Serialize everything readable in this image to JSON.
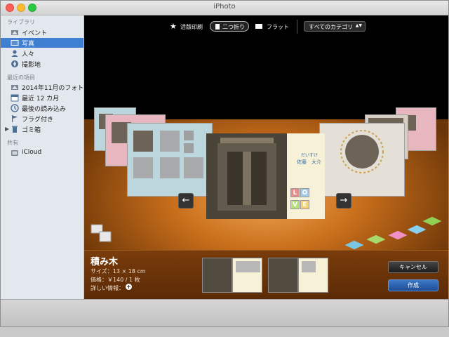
{
  "window": {
    "title": "iPhoto"
  },
  "sidebar": {
    "sections": [
      {
        "heading": "ライブラリ",
        "items": [
          {
            "label": "イベント",
            "icon": "events-icon"
          },
          {
            "label": "写真",
            "icon": "photos-icon",
            "selected": true
          },
          {
            "label": "人々",
            "icon": "people-icon"
          },
          {
            "label": "撮影地",
            "icon": "places-icon"
          }
        ]
      },
      {
        "heading": "最近の項目",
        "items": [
          {
            "label": "2014年11月のフォト…",
            "icon": "event-icon"
          },
          {
            "label": "最近 12 カ月",
            "icon": "calendar-icon"
          },
          {
            "label": "最後の読み込み",
            "icon": "last-import-icon"
          },
          {
            "label": "フラグ付き",
            "icon": "flag-icon"
          },
          {
            "label": "ゴミ箱",
            "icon": "trash-icon"
          }
        ]
      },
      {
        "heading": "共有",
        "items": [
          {
            "label": "iCloud",
            "icon": "icloud-icon"
          }
        ]
      }
    ]
  },
  "toolbar": {
    "letterpress": "活版印刷",
    "folded": "二つ折り",
    "flat": "フラット",
    "category": "すべてのカテゴリ"
  },
  "card_preview": {
    "name_small": "だいすけ",
    "name": "佐藤　大介",
    "blocks": [
      "L",
      "O",
      "V",
      "E"
    ]
  },
  "product": {
    "title": "積み木",
    "size": "サイズ：13 × 18 cm",
    "price": "価格：￥140 / 1 枚",
    "details": "詳しい情報："
  },
  "buttons": {
    "cancel": "キャンセル",
    "create": "作成"
  },
  "colors": {
    "selection": "#3f7fd2",
    "create_button": "#2a62b0",
    "floor": "#d17a22"
  }
}
